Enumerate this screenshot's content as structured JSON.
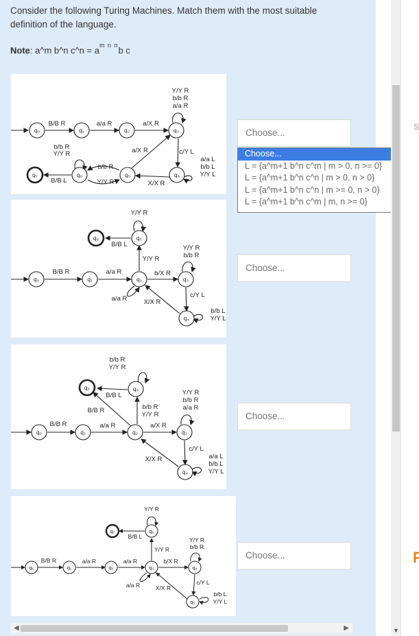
{
  "question": {
    "text": "Consider the following Turing Machines. Match them with the most suitable definition of the language.",
    "note_label": "Note",
    "note_text": ": a^m b^n c^n = a",
    "note_sup": "m n n",
    "note_tail": "b c"
  },
  "selects": [
    {
      "value": "Choose..."
    },
    {
      "value": "Choose..."
    },
    {
      "value": "Choose..."
    },
    {
      "value": "Choose..."
    }
  ],
  "dropdown": {
    "options": [
      "Choose...",
      "L = {a^m+1 b^n c^m  |  m > 0, n >= 0}",
      "L = {a^m+1 b^n c^n  |  m > 0, n > 0}",
      "L = {a^m+1 b^n c^n  |  m >= 0, n > 0}",
      "L = {a^m+1 b^n c^m  |  m, n >= 0}"
    ],
    "selected_index": 0
  },
  "machines": [
    {
      "labels": {
        "q0": "q₀",
        "q1": "q₁",
        "q2": "q₂",
        "q3": "q₃",
        "q4": "q₄",
        "q5": "q₅",
        "q6": "q₆",
        "q7": "q₇",
        "t01": "B/B R",
        "t12": "a/a R",
        "t23": "a/X R",
        "loop3a": "Y/Y R",
        "loop3b": "b/b R",
        "loop3c": "a/a R",
        "t34": "c/Y L",
        "loop4a": "a/a L",
        "loop4b": "b/b L",
        "loop4c": "Y/Y L",
        "t45": "X/X R",
        "t53": "a/X R",
        "t56": "b/b R",
        "t65": "Y/Y R",
        "loop6a": "b/b R",
        "loop6b": "Y/Y R",
        "t67": "B/B L"
      }
    },
    {
      "labels": {
        "q0": "q₀",
        "q1": "q₁",
        "q2": "q₂",
        "q3": "q₃",
        "q4": "q₄",
        "q5": "q₅",
        "q6": "q₆",
        "t01": "B/B R",
        "t12": "a/a R",
        "loop2": "a/a R",
        "t23": "b/X R",
        "loop3a": "Y/Y R",
        "loop3b": "b/b R",
        "t34": "c/Y L",
        "loop4a": "b/b L",
        "loop4b": "Y/Y L",
        "t42": "X/X R",
        "t25": "Y/Y R",
        "loop5": "Y/Y R",
        "t56": "B/B L"
      }
    },
    {
      "labels": {
        "q0": "q₀",
        "q1": "q₁",
        "q2": "q₂",
        "q3": "q₃",
        "q4": "q₄",
        "q5": "q₅",
        "q6": "q₆",
        "t01": "B/B R",
        "t12": "a/a R",
        "t23": "a/X R",
        "loop3a": "Y/Y R",
        "loop3b": "b/b R",
        "loop3c": "a/a R",
        "t34": "c/Y L",
        "loop4a": "a/a L",
        "loop4b": "b/b L",
        "loop4c": "Y/Y L",
        "t42": "X/X R",
        "t26": "B/B R",
        "t25a": "b/b R",
        "t25b": "Y/Y R",
        "loop5a": "b/b R",
        "loop5b": "Y/Y R",
        "t56": "B/B L"
      }
    },
    {
      "labels": {
        "q0": "q₀",
        "q1": "q₁",
        "q2": "q₂",
        "q3": "q₃",
        "q4": "q₄",
        "q5": "q₅",
        "q6": "q₆",
        "q7": "q₇",
        "t01": "B/B R",
        "t12": "a/a R",
        "t23": "a/a R",
        "loop3": "a/a R",
        "t34": "b/X R",
        "loop4a": "Y/Y R",
        "loop4b": "b/b R",
        "t45": "c/Y L",
        "loop5a": "b/b L",
        "loop5b": "Y/Y L",
        "t53": "X/X R",
        "t36": "Y/Y R",
        "loop6": "Y/Y R",
        "t67": "B/B L"
      }
    }
  ],
  "side": {
    "s_label": "Sl",
    "f_label": "F"
  }
}
